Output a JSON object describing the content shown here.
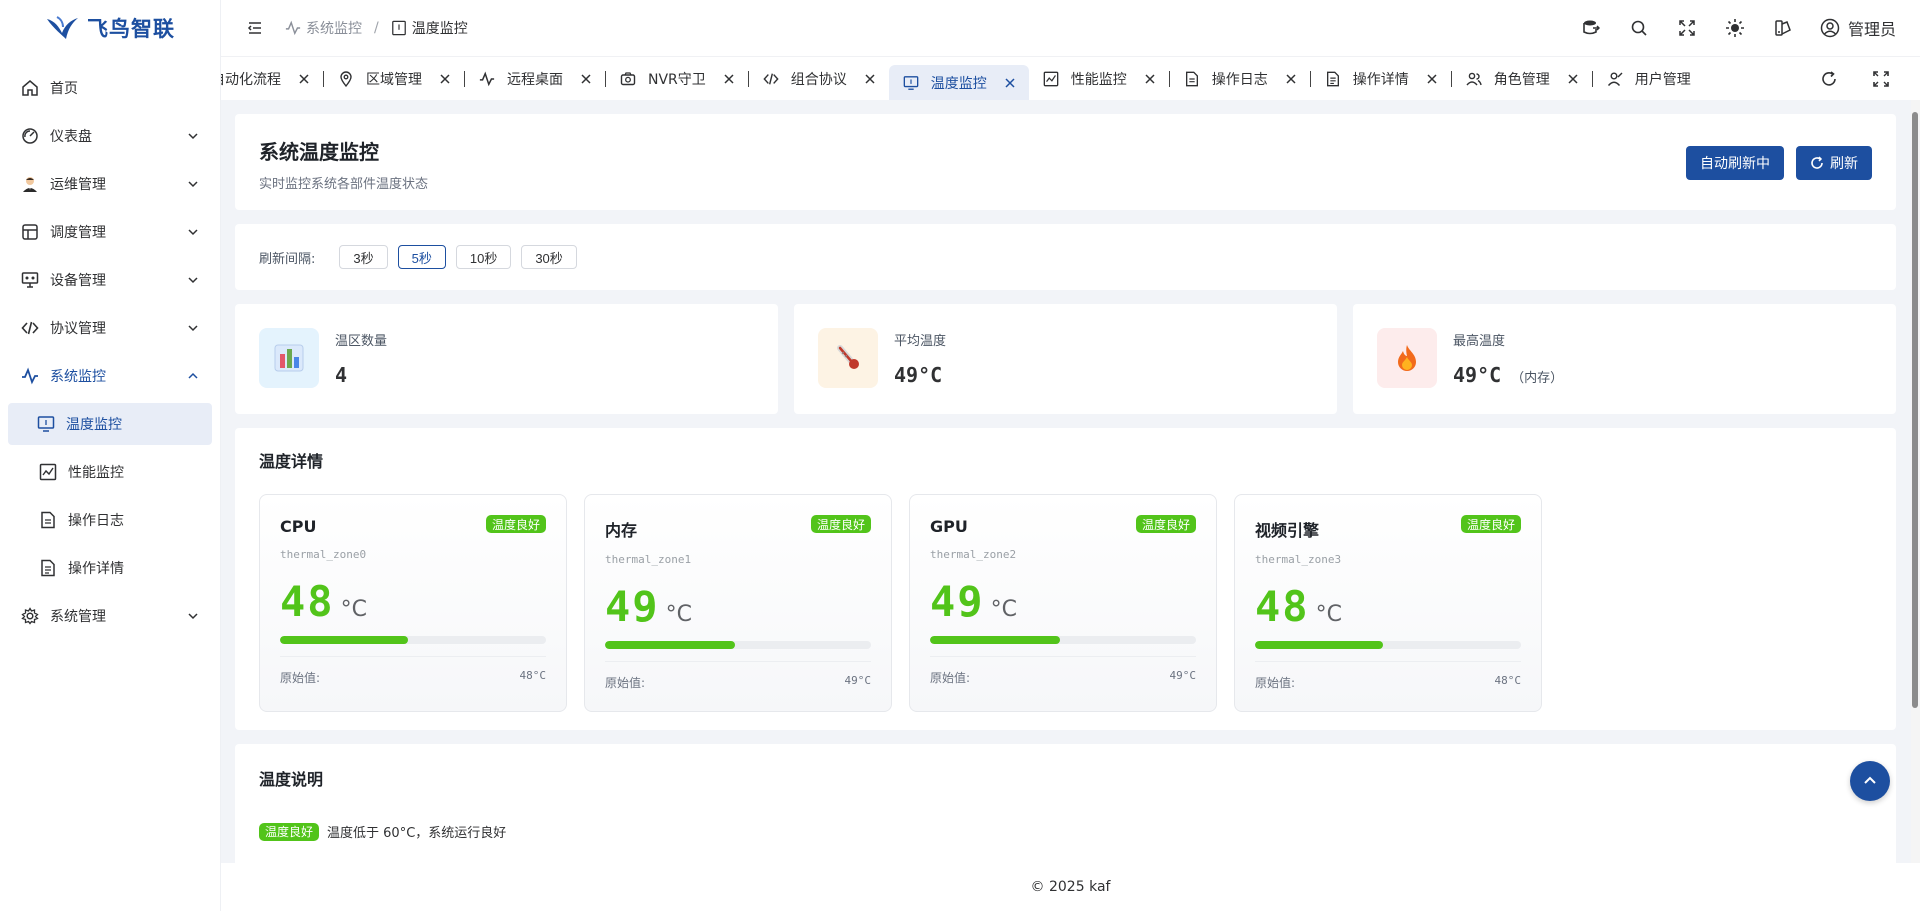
{
  "app": {
    "brand": "飞鸟智联",
    "user": "管理员",
    "footer": "© 2025 kaf"
  },
  "sidebar": {
    "items": [
      {
        "label": "首页",
        "icon": "home-icon"
      },
      {
        "label": "仪表盘",
        "icon": "dashboard-icon"
      },
      {
        "label": "运维管理",
        "icon": "operator-avatar-icon"
      },
      {
        "label": "调度管理",
        "icon": "schedule-icon"
      },
      {
        "label": "设备管理",
        "icon": "device-icon"
      },
      {
        "label": "协议管理",
        "icon": "code-icon"
      },
      {
        "label": "系统监控",
        "icon": "pulse-icon"
      },
      {
        "label": "系统管理",
        "icon": "gear-icon"
      }
    ],
    "monitor_sub": [
      {
        "label": "温度监控",
        "icon": "monitor-icon"
      },
      {
        "label": "性能监控",
        "icon": "chart-icon"
      },
      {
        "label": "操作日志",
        "icon": "doc-icon"
      },
      {
        "label": "操作详情",
        "icon": "doc-detail-icon"
      }
    ]
  },
  "header": {
    "breadcrumb": [
      "系统监控",
      "温度监控"
    ]
  },
  "tabs": [
    {
      "label": "自动化流程",
      "icon": ""
    },
    {
      "label": "区域管理",
      "icon": "location-icon"
    },
    {
      "label": "远程桌面",
      "icon": "pulse-icon"
    },
    {
      "label": "NVR守卫",
      "icon": "camera-icon"
    },
    {
      "label": "组合协议",
      "icon": "code-icon"
    },
    {
      "label": "温度监控",
      "icon": "monitor-icon",
      "active": true
    },
    {
      "label": "性能监控",
      "icon": "chart-icon"
    },
    {
      "label": "操作日志",
      "icon": "doc-icon"
    },
    {
      "label": "操作详情",
      "icon": "doc-detail-icon"
    },
    {
      "label": "角色管理",
      "icon": "users-icon"
    },
    {
      "label": "用户管理",
      "icon": "user-icon"
    }
  ],
  "page": {
    "title": "系统温度监控",
    "subtitle": "实时监控系统各部件温度状态",
    "auto_refresh_label": "自动刷新中",
    "refresh_label": "刷新",
    "interval_label": "刷新间隔:",
    "intervals": [
      "3秒",
      "5秒",
      "10秒",
      "30秒"
    ],
    "active_interval": "5秒"
  },
  "stats": {
    "zones_label": "温区数量",
    "zones_value": "4",
    "avg_label": "平均温度",
    "avg_value": "49°C",
    "max_label": "最高温度",
    "max_value": "49°C",
    "max_extra": "（内存）"
  },
  "details": {
    "title": "温度详情",
    "raw_label": "原始值:",
    "cards": [
      {
        "name": "CPU",
        "zone": "thermal_zone0",
        "value": "48",
        "unit": "°C",
        "status": "温度良好",
        "raw": "48°C",
        "level": 0.48
      },
      {
        "name": "内存",
        "zone": "thermal_zone1",
        "value": "49",
        "unit": "°C",
        "status": "温度良好",
        "raw": "49°C",
        "level": 0.49
      },
      {
        "name": "GPU",
        "zone": "thermal_zone2",
        "value": "49",
        "unit": "°C",
        "status": "温度良好",
        "raw": "49°C",
        "level": 0.49
      },
      {
        "name": "视频引擎",
        "zone": "thermal_zone3",
        "value": "48",
        "unit": "°C",
        "status": "温度良好",
        "raw": "48°C",
        "level": 0.48
      }
    ]
  },
  "explain": {
    "title": "温度说明",
    "badge": "温度良好",
    "text": "温度低于 60°C，系统运行良好"
  },
  "colors": {
    "accent": "#1d4fa0",
    "good": "#52c41a"
  }
}
